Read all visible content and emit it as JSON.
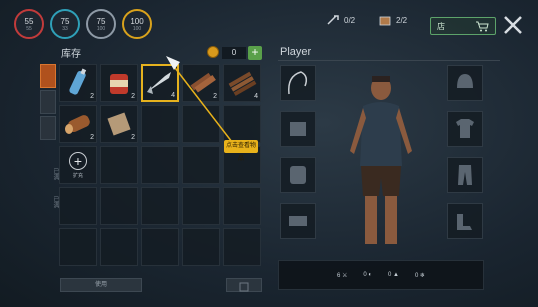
{
  "stats": [
    {
      "value": "55",
      "sub": "55",
      "color": "#c23b3b"
    },
    {
      "value": "75",
      "sub": "33",
      "color": "#2fa0b8"
    },
    {
      "value": "75",
      "sub": "100",
      "color": "#8e9aa6"
    },
    {
      "value": "100",
      "sub": "100",
      "color": "#d9a21c"
    }
  ],
  "topbar": {
    "tools_count": "0/2",
    "bag_count": "2/2",
    "shop_label": "店"
  },
  "inventory": {
    "title": "库存",
    "coins": "0",
    "side_labels": [
      "已满",
      "已满"
    ],
    "items": [
      {
        "icon": "water-bottle-icon",
        "count": "2"
      },
      {
        "icon": "canned-food-icon",
        "count": "2"
      },
      {
        "icon": "fish-icon",
        "count": "4"
      },
      {
        "icon": "wood-plank-icon",
        "count": "2"
      },
      {
        "icon": "firewood-bundle-icon",
        "count": "4"
      },
      {
        "icon": "log-icon",
        "count": "2"
      },
      {
        "icon": "cloth-icon",
        "count": "2"
      }
    ],
    "add_label": "扩充",
    "use_label": "使用",
    "tooltip": "点击查看物品"
  },
  "player": {
    "title": "Player",
    "slots": [
      "fishing-rod-icon",
      "hat-icon",
      "pocket-icon",
      "shirt-icon",
      "backpack-icon",
      "pants-icon",
      "belt-icon",
      "boots-icon"
    ],
    "stats": [
      "6",
      "0",
      "0",
      "0"
    ]
  }
}
